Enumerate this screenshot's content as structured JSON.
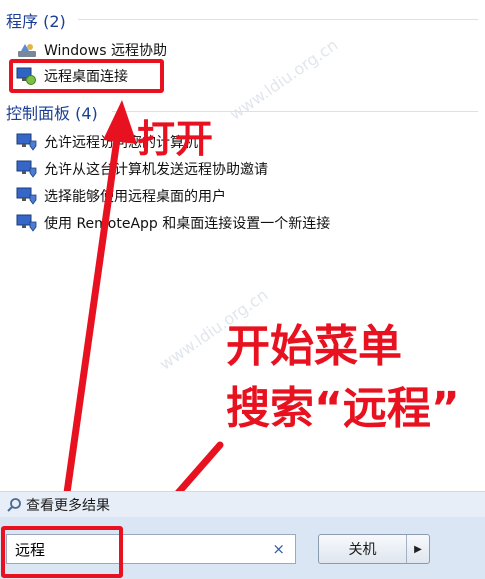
{
  "programs": {
    "header": "程序 (2)",
    "items": [
      {
        "label": "Windows 远程协助",
        "icon": "remote-assist-icon"
      },
      {
        "label": "远程桌面连接",
        "icon": "remote-desktop-icon"
      }
    ]
  },
  "control_panel": {
    "header": "控制面板 (4)",
    "items": [
      {
        "label": "允许远程访问您的计算机",
        "icon": "monitor-shield-icon"
      },
      {
        "label": "允许从这台计算机发送远程协助邀请",
        "icon": "monitor-shield-icon"
      },
      {
        "label": "选择能够使用远程桌面的用户",
        "icon": "monitor-shield-icon"
      },
      {
        "label": "使用 RemoteApp 和桌面连接设置一个新连接",
        "icon": "monitor-shield-icon"
      }
    ]
  },
  "annotations": {
    "open": "打开",
    "line1": "开始菜单",
    "line2": "搜索“远程”"
  },
  "footer": {
    "see_more": "查看更多结果"
  },
  "search": {
    "value": "远程",
    "clear": "×"
  },
  "shutdown": {
    "label": "关机",
    "arrow": "▶"
  },
  "watermarks": [
    "www.ldiu.org.cn",
    "www.ldiu.org.cn"
  ],
  "colors": {
    "annotation": "#e8111f",
    "header": "#1c3f94"
  }
}
